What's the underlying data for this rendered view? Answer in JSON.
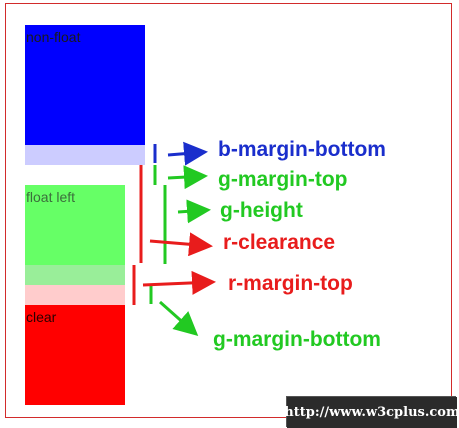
{
  "boxes": {
    "nonfloat_label": "non-float",
    "floatleft_label": "float left",
    "clear_label": "clear"
  },
  "annotations": {
    "b_margin_bottom": "b-margin-bottom",
    "g_margin_top": "g-margin-top",
    "g_height": "g-height",
    "r_clearance": "r-clearance",
    "r_margin_top": "r-margin-top",
    "g_margin_bottom": "g-margin-bottom"
  },
  "colors": {
    "blue": "#0000ff",
    "blue_margin": "#ccccff",
    "green": "#66ff66",
    "green_margin": "#99ff99",
    "red": "#ff0000",
    "red_margin": "#ffcccc",
    "label_blue": "#1a2ecc",
    "label_green": "#22c922",
    "label_red": "#e81c1c"
  },
  "watermark": "http://www.w3cplus.com"
}
